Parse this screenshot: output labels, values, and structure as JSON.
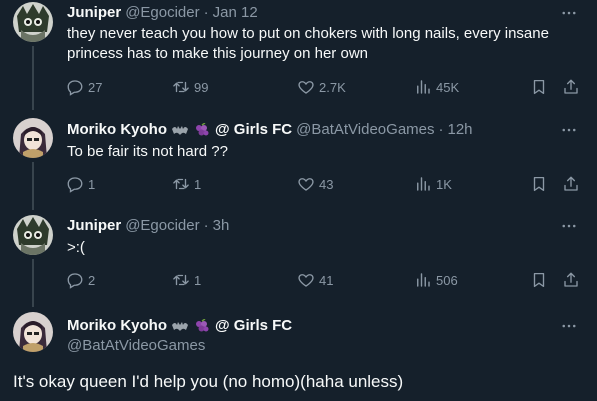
{
  "tweets": [
    {
      "name": "Juniper",
      "handle": "@Egocider",
      "time": "Jan 12",
      "text_lines": [
        "they never teach you how to put on chokers with long nails, every insane",
        "princess has to make this journey on her own"
      ],
      "counts": {
        "replies": "27",
        "retweets": "99",
        "likes": "2.7K",
        "views": "45K"
      }
    },
    {
      "name": "Moriko Kyoho",
      "name_suffix": "@ Girls FC",
      "handle": "@BatAtVideoGames",
      "time": "12h",
      "text": "To be fair its not hard ??",
      "counts": {
        "replies": "1",
        "retweets": "1",
        "likes": "43",
        "views": "1K"
      }
    },
    {
      "name": "Juniper",
      "handle": "@Egocider",
      "time": "3h",
      "text": ">:(",
      "counts": {
        "replies": "2",
        "retweets": "1",
        "likes": "41",
        "views": "506"
      }
    }
  ],
  "main_tweet": {
    "name": "Moriko Kyoho",
    "name_suffix": "@ Girls FC",
    "handle": "@BatAtVideoGames",
    "text": "It's okay queen I'd help you (no homo)(haha unless)"
  },
  "separator": "·",
  "colors": {
    "background": "#15202b",
    "muted": "#8b98a5",
    "text": "#f7f9f9",
    "thread_line": "#38444d"
  },
  "icons": [
    "more-icon",
    "reply-icon",
    "retweet-icon",
    "like-icon",
    "views-icon",
    "bookmark-icon",
    "share-icon",
    "bat-emoji-icon",
    "grapes-emoji-icon"
  ]
}
